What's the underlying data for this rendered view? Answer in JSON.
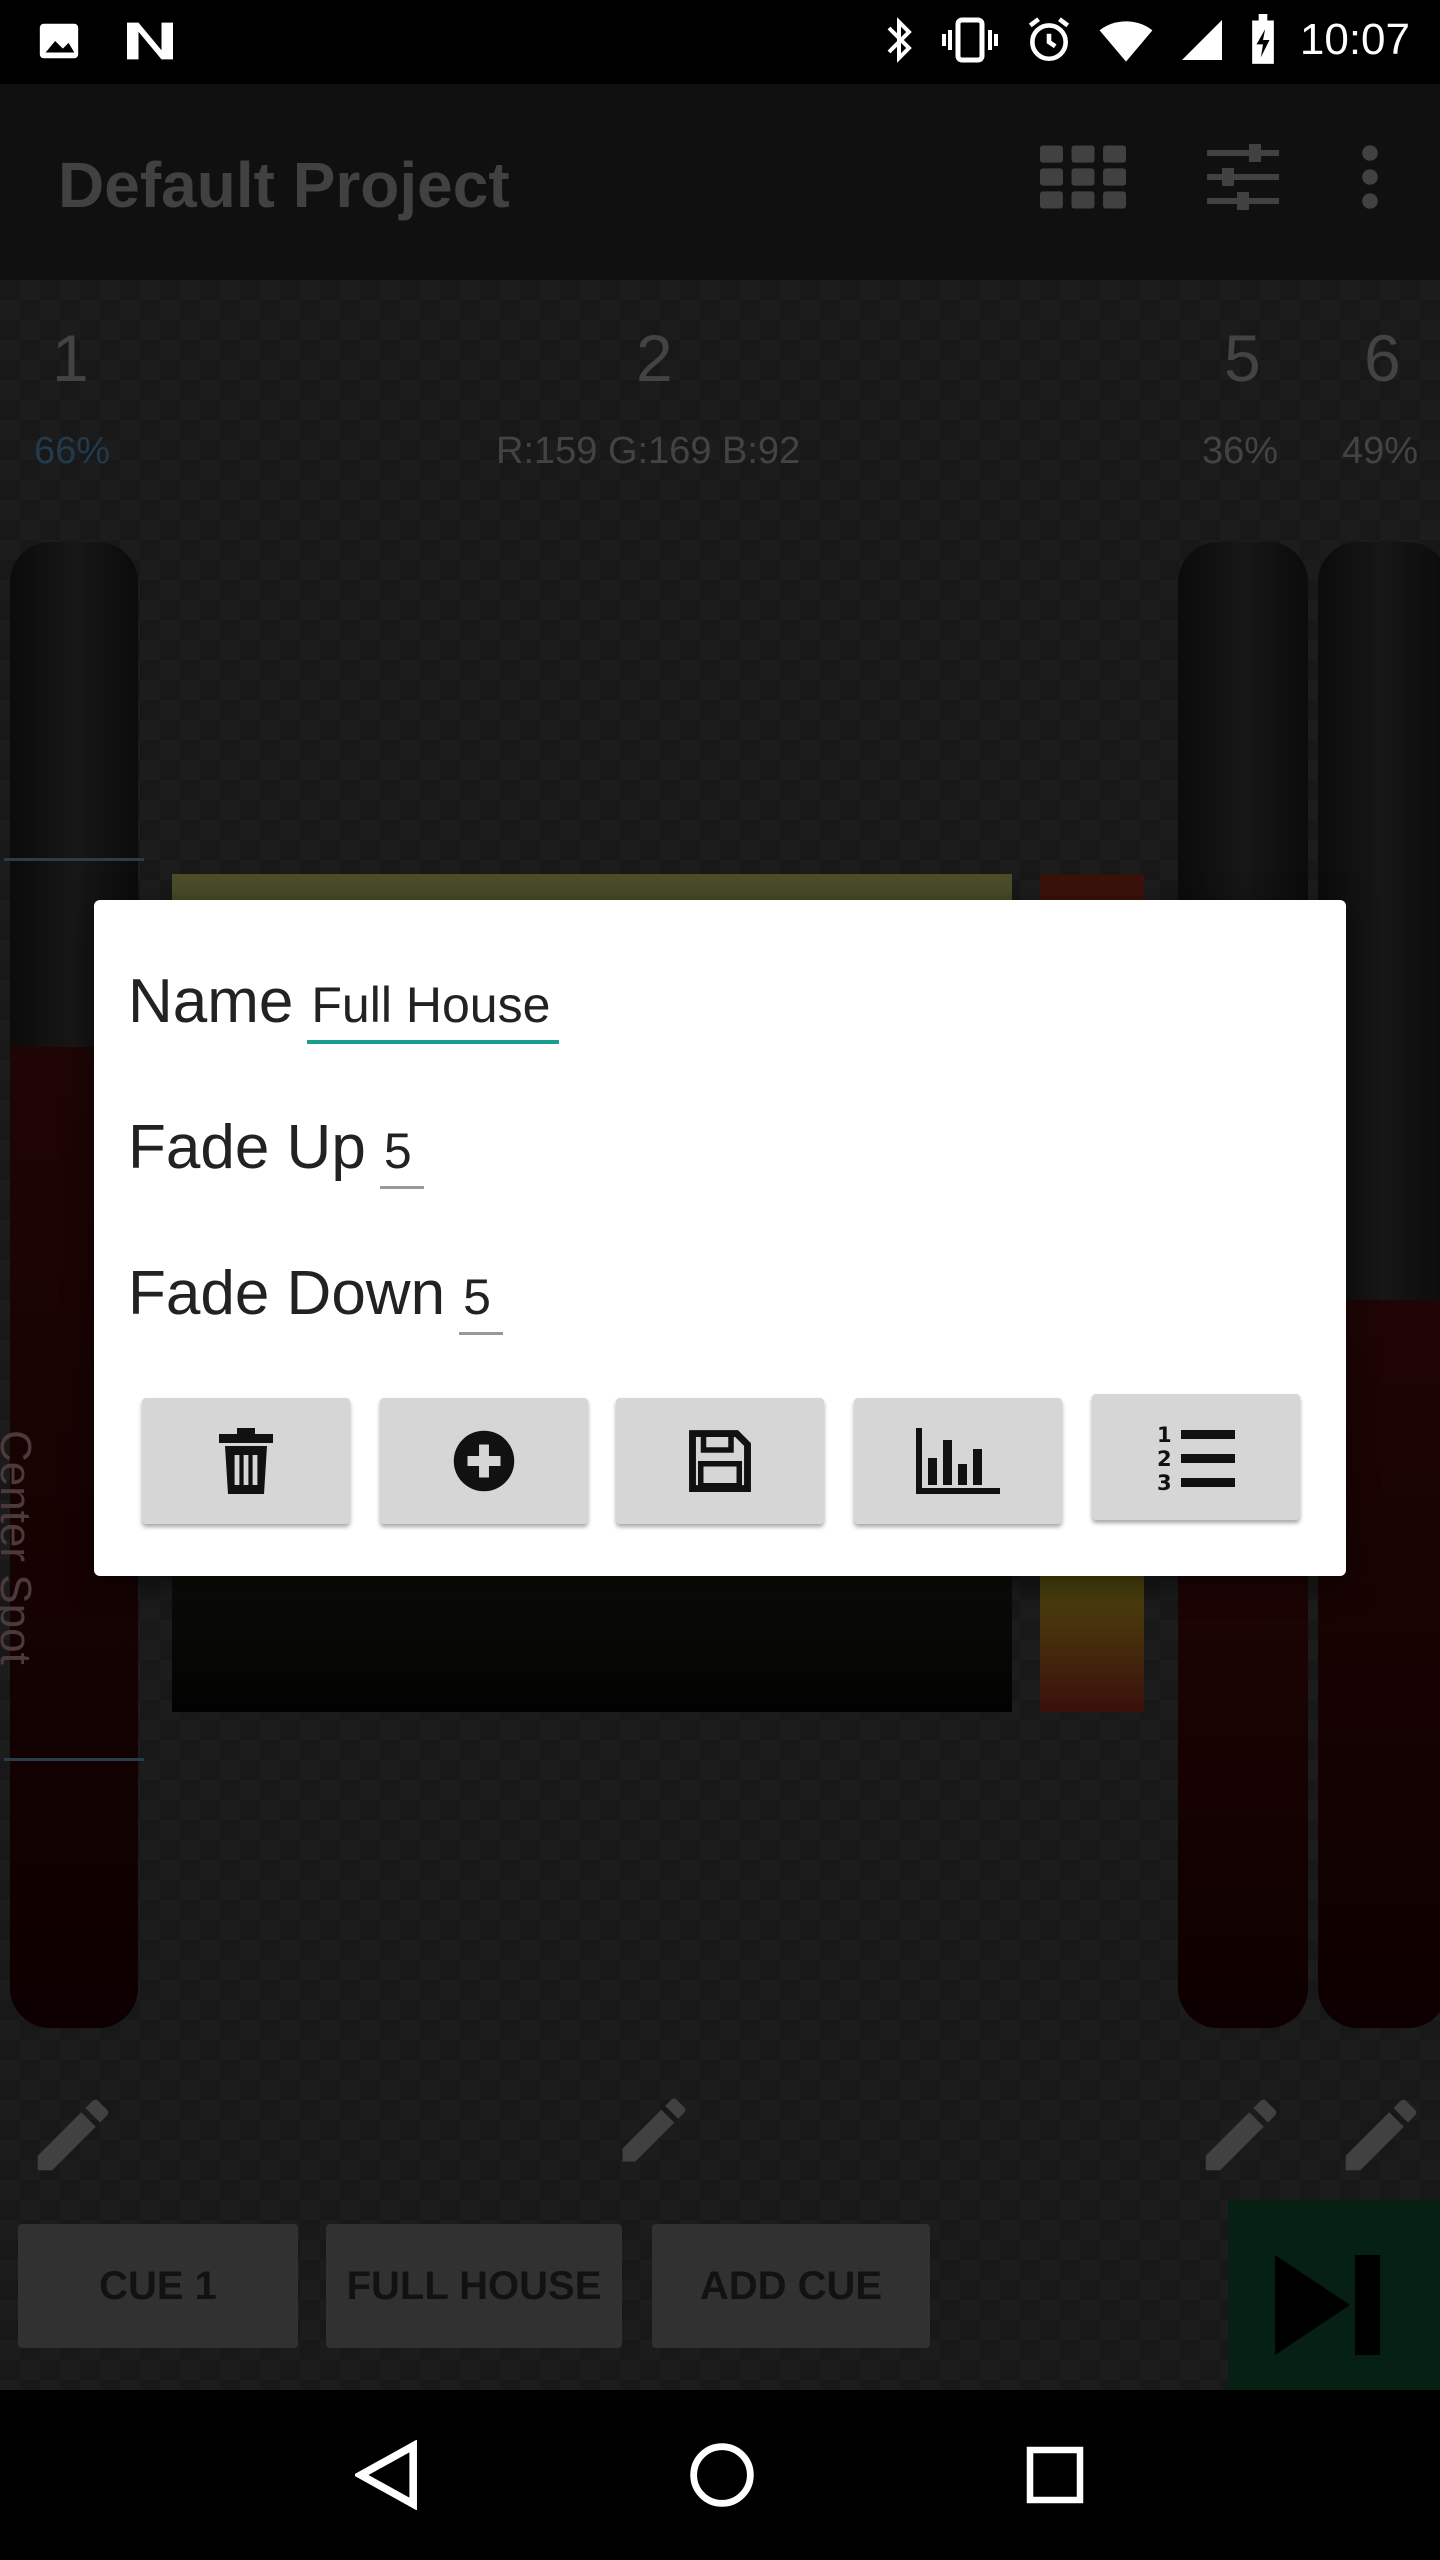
{
  "status_bar": {
    "time": "10:07"
  },
  "app_bar": {
    "title": "Default Project"
  },
  "channels": [
    {
      "num": "1",
      "value": "66%",
      "level": 0.66
    },
    {
      "num": "2",
      "value": "R:159 G:169 B:92"
    },
    {
      "num": "5",
      "value": "36%",
      "level": 0.36
    },
    {
      "num": "6",
      "value": "49%",
      "level": 0.49
    }
  ],
  "slider_label": "Center Spot",
  "cues": [
    {
      "label": "CUE 1"
    },
    {
      "label": "FULL HOUSE"
    },
    {
      "label": "ADD CUE"
    }
  ],
  "dialog": {
    "name_label": "Name",
    "name_value": "Full House",
    "fade_up_label": "Fade Up",
    "fade_up_value": "5",
    "fade_down_label": "Fade Down",
    "fade_down_value": "5",
    "buttons": [
      {
        "icon": "trash-icon"
      },
      {
        "icon": "plus-circle-icon"
      },
      {
        "icon": "save-icon"
      },
      {
        "icon": "bar-chart-icon"
      },
      {
        "icon": "numbered-list-icon"
      }
    ]
  },
  "colors": {
    "accent": "#1a9c8f",
    "play": "#0b3d24"
  }
}
